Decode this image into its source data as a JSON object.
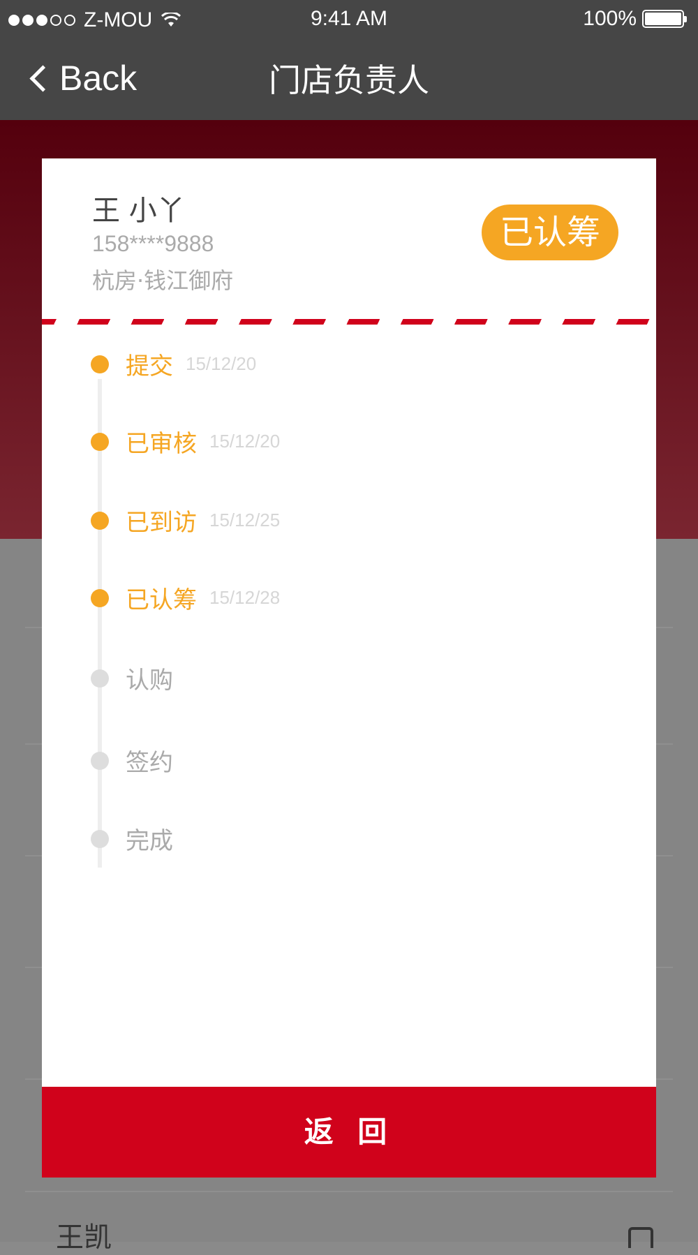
{
  "status_bar": {
    "carrier": "Z-MOU",
    "time": "9:41 AM",
    "battery": "100%",
    "signal_bars_full": 3,
    "signal_bars_total": 5
  },
  "nav": {
    "back_label": "Back",
    "title": "门店负责人"
  },
  "customer": {
    "name": "王 小丫",
    "phone": "158****9888",
    "project": "杭房·钱江御府",
    "status": "已认筹"
  },
  "timeline": [
    {
      "label": "提交",
      "date": "15/12/20",
      "done": true
    },
    {
      "label": "已审核",
      "date": "15/12/20",
      "done": true
    },
    {
      "label": "已到访",
      "date": "15/12/25",
      "done": true
    },
    {
      "label": "已认筹",
      "date": "15/12/28",
      "done": true
    },
    {
      "label": "认购",
      "date": "",
      "done": false
    },
    {
      "label": "签约",
      "date": "",
      "done": false
    },
    {
      "label": "完成",
      "date": "",
      "done": false
    }
  ],
  "actions": {
    "return_label": "返 回"
  },
  "background": {
    "partial_name": "王凯"
  },
  "colors": {
    "accent": "#f5a623",
    "primary": "#d0021b",
    "navbar": "#464646"
  }
}
